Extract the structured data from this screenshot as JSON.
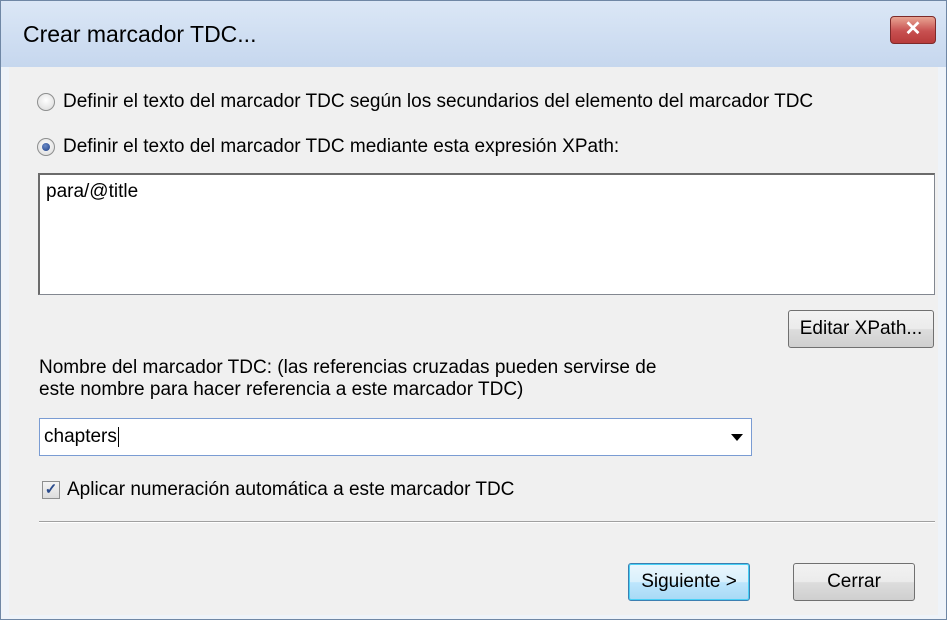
{
  "window": {
    "title": "Crear marcador TDC...",
    "close_label": "✕"
  },
  "options": {
    "radio_children": "Definir el texto del marcador TDC según los secundarios del elemento del marcador TDC",
    "radio_xpath": "Definir el texto del marcador TDC mediante esta expresión XPath:",
    "selected": "radio_xpath"
  },
  "xpath": {
    "value": "para/@title",
    "edit_button_label": "Editar XPath..."
  },
  "name_field": {
    "label_line1": "Nombre del marcador TDC: (las referencias cruzadas pueden servirse de",
    "label_line2": "este nombre para hacer referencia a este marcador TDC)",
    "value": "chapters"
  },
  "auto_numbering": {
    "label": "Aplicar numeración automática a este marcador TDC",
    "checked": true,
    "check_glyph": "✓"
  },
  "buttons": {
    "next_label": "Siguiente >",
    "close_label": "Cerrar"
  }
}
